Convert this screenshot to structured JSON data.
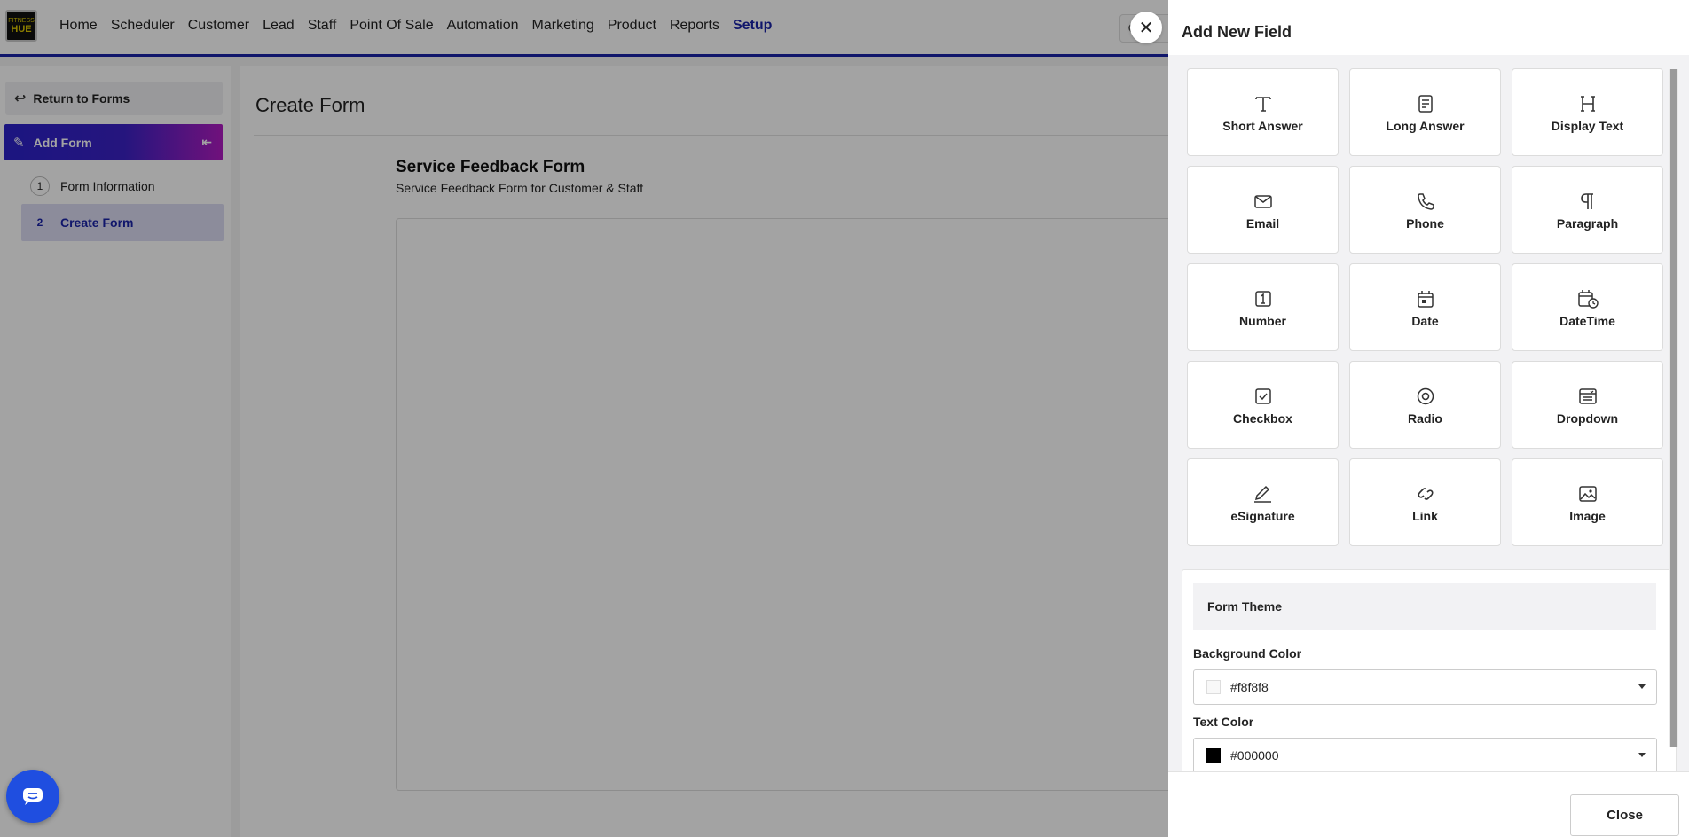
{
  "app": {
    "logo_line1": "FITNESS",
    "logo_line2": "HUE"
  },
  "nav": {
    "items": [
      "Home",
      "Scheduler",
      "Customer",
      "Lead",
      "Staff",
      "Point Of Sale",
      "Automation",
      "Marketing",
      "Product",
      "Reports",
      "Setup"
    ],
    "active": "Setup"
  },
  "sidebar": {
    "return_label": "Return to Forms",
    "add_form_label": "Add Form",
    "steps": [
      {
        "num": "1",
        "label": "Form Information"
      },
      {
        "num": "2",
        "label": "Create Form"
      }
    ]
  },
  "main": {
    "title": "Create Form",
    "form_name": "Service Feedback Form",
    "form_description": "Service Feedback Form for Customer & Staff"
  },
  "drawer": {
    "title": "Add New Field",
    "field_types": [
      {
        "label": "Short Answer",
        "icon": "text-t-icon"
      },
      {
        "label": "Long Answer",
        "icon": "document-lines-icon"
      },
      {
        "label": "Display Text",
        "icon": "heading-h-icon"
      },
      {
        "label": "Email",
        "icon": "envelope-icon"
      },
      {
        "label": "Phone",
        "icon": "phone-icon"
      },
      {
        "label": "Paragraph",
        "icon": "pilcrow-icon"
      },
      {
        "label": "Number",
        "icon": "number-one-icon"
      },
      {
        "label": "Date",
        "icon": "calendar-icon"
      },
      {
        "label": "DateTime",
        "icon": "calendar-clock-icon"
      },
      {
        "label": "Checkbox",
        "icon": "checkbox-icon"
      },
      {
        "label": "Radio",
        "icon": "radio-icon"
      },
      {
        "label": "Dropdown",
        "icon": "dropdown-list-icon"
      },
      {
        "label": "eSignature",
        "icon": "pen-icon"
      },
      {
        "label": "Link",
        "icon": "link-icon"
      },
      {
        "label": "Image",
        "icon": "image-icon"
      }
    ],
    "theme": {
      "heading": "Form Theme",
      "background_label": "Background Color",
      "background_value": "#f8f8f8",
      "text_label": "Text Color",
      "text_value": "#000000"
    },
    "close_label": "Close"
  },
  "colors": {
    "accent": "#1a23a8",
    "gradient_start": "#2b22c9",
    "gradient_end": "#b01cc2",
    "chat_button": "#1f4ee0"
  }
}
